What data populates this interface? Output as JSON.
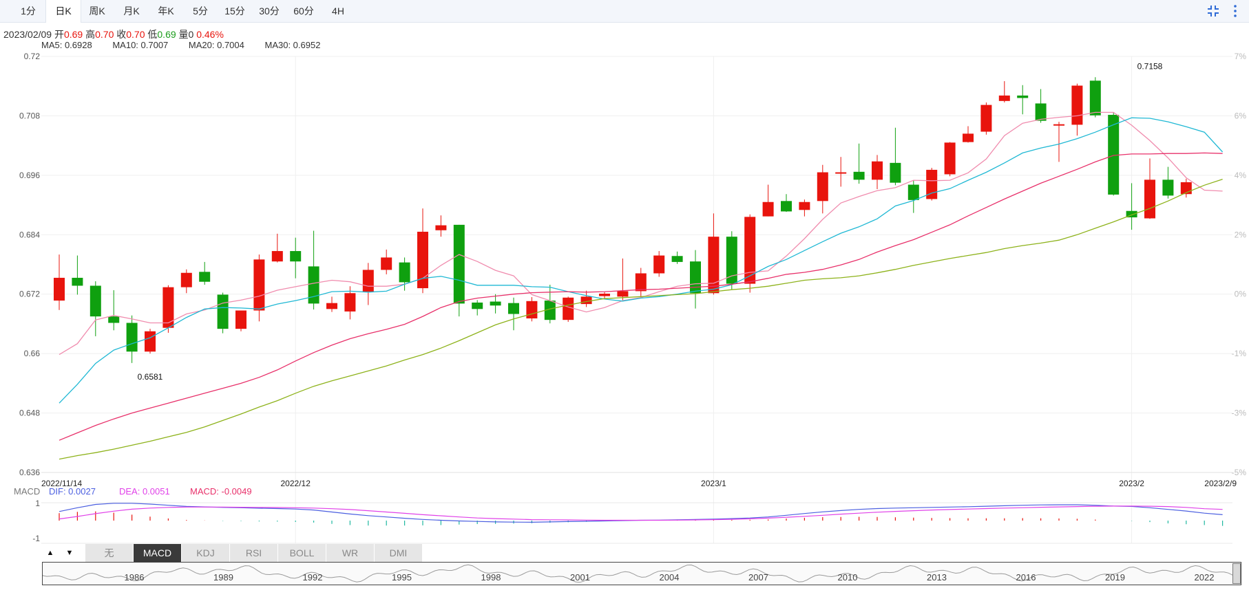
{
  "tabs": [
    {
      "label": "1分",
      "active": false
    },
    {
      "label": "日K",
      "active": true
    },
    {
      "label": "周K",
      "active": false
    },
    {
      "label": "月K",
      "active": false
    },
    {
      "label": "年K",
      "active": false
    },
    {
      "label": "5分",
      "active": false
    },
    {
      "label": "15分",
      "active": false
    },
    {
      "label": "30分",
      "active": false
    },
    {
      "label": "60分",
      "active": false
    },
    {
      "label": "4H",
      "active": false
    }
  ],
  "info": {
    "date": "2023/02/09",
    "open_label": "开",
    "open": "0.69",
    "high_label": "高",
    "high": "0.70",
    "close_label": "收",
    "close": "0.70",
    "low_label": "低",
    "low": "0.69",
    "volume_label": "量",
    "volume": "0",
    "change": "0.46%"
  },
  "ma_legend": [
    {
      "text": "MA5: 0.6928",
      "color": "#f08cae"
    },
    {
      "text": "MA10: 0.7007",
      "color": "#1fb8d4"
    },
    {
      "text": "MA20: 0.7004",
      "color": "#e8306a"
    },
    {
      "text": "MA30: 0.6952",
      "color": "#8db21a"
    }
  ],
  "macd_legend": {
    "title": "MACD",
    "dif": "DIF: 0.0027",
    "dea": "DEA: 0.0051",
    "macd": "MACD: -0.0049"
  },
  "indicator_tabs": [
    {
      "label": "无",
      "active": false
    },
    {
      "label": "MACD",
      "active": true
    },
    {
      "label": "KDJ",
      "active": false
    },
    {
      "label": "RSI",
      "active": false
    },
    {
      "label": "BOLL",
      "active": false
    },
    {
      "label": "WR",
      "active": false
    },
    {
      "label": "DMI",
      "active": false
    }
  ],
  "nav_arrows": {
    "up": "▲",
    "down": "▼"
  },
  "colors": {
    "up": "#e8140d",
    "down": "#0fa00f",
    "dif": "#4a5ee0",
    "dea": "#e040e8"
  },
  "chart_data": {
    "type": "candlestick",
    "ylim": [
      0.636,
      0.72
    ],
    "y_ticks": [
      "0.72",
      "0.708",
      "0.696",
      "0.684",
      "0.672",
      "0.66",
      "0.648",
      "0.636"
    ],
    "pct_ticks": [
      "7%",
      "6%",
      "4%",
      "2%",
      "0%",
      "-1%",
      "-3%",
      "-5%"
    ],
    "x_labels": [
      {
        "label": "2022/11/14",
        "index": 0
      },
      {
        "label": "2022/12",
        "index": 13
      },
      {
        "label": "2023/1",
        "index": 36
      },
      {
        "label": "2023/2",
        "index": 59
      },
      {
        "label": "2023/2/9",
        "index": 65
      }
    ],
    "annotations": [
      {
        "text": "0.6581",
        "index": 5,
        "value": 0.6581,
        "position": "below"
      },
      {
        "text": "0.7158",
        "index": 60,
        "value": 0.7158,
        "position": "above"
      }
    ],
    "candles": [
      [
        0.6707,
        0.6753,
        0.6688,
        0.68
      ],
      [
        0.6753,
        0.6737,
        0.6719,
        0.6798
      ],
      [
        0.6737,
        0.6675,
        0.6635,
        0.6746
      ],
      [
        0.6675,
        0.6662,
        0.6647,
        0.6728
      ],
      [
        0.6662,
        0.6604,
        0.6581,
        0.6677
      ],
      [
        0.6604,
        0.6645,
        0.66,
        0.665
      ],
      [
        0.6652,
        0.6734,
        0.6642,
        0.6738
      ],
      [
        0.6734,
        0.6763,
        0.6722,
        0.677
      ],
      [
        0.6765,
        0.6745,
        0.6739,
        0.6785
      ],
      [
        0.6719,
        0.665,
        0.6641,
        0.6723
      ],
      [
        0.665,
        0.6687,
        0.6645,
        0.6687
      ],
      [
        0.6687,
        0.679,
        0.6665,
        0.68
      ],
      [
        0.6786,
        0.6807,
        0.6784,
        0.6842
      ],
      [
        0.6807,
        0.6786,
        0.6752,
        0.6834
      ],
      [
        0.6776,
        0.6701,
        0.6689,
        0.6848
      ],
      [
        0.669,
        0.6702,
        0.6684,
        0.6715
      ],
      [
        0.6685,
        0.6722,
        0.6669,
        0.6736
      ],
      [
        0.6725,
        0.6769,
        0.6698,
        0.6783
      ],
      [
        0.6769,
        0.6794,
        0.676,
        0.681
      ],
      [
        0.6784,
        0.6744,
        0.6727,
        0.6794
      ],
      [
        0.6732,
        0.6846,
        0.6722,
        0.6893
      ],
      [
        0.6849,
        0.6859,
        0.6836,
        0.6879
      ],
      [
        0.686,
        0.6701,
        0.6675,
        0.686
      ],
      [
        0.6703,
        0.669,
        0.6677,
        0.6708
      ],
      [
        0.6705,
        0.6697,
        0.6681,
        0.672
      ],
      [
        0.6702,
        0.668,
        0.6647,
        0.6713
      ],
      [
        0.6671,
        0.6706,
        0.6665,
        0.6714
      ],
      [
        0.6707,
        0.6668,
        0.6661,
        0.6739
      ],
      [
        0.6668,
        0.6713,
        0.6664,
        0.6715
      ],
      [
        0.67,
        0.6715,
        0.6694,
        0.6727
      ],
      [
        0.6716,
        0.6721,
        0.6711,
        0.6724
      ],
      [
        0.6715,
        0.6726,
        0.6708,
        0.6792
      ],
      [
        0.6726,
        0.6762,
        0.6713,
        0.6773
      ],
      [
        0.6762,
        0.6798,
        0.6755,
        0.6807
      ],
      [
        0.6797,
        0.6785,
        0.6781,
        0.6806
      ],
      [
        0.6786,
        0.6722,
        0.6691,
        0.6809
      ],
      [
        0.6722,
        0.6836,
        0.6719,
        0.6883
      ],
      [
        0.6836,
        0.6741,
        0.673,
        0.6847
      ],
      [
        0.6741,
        0.6876,
        0.6723,
        0.6881
      ],
      [
        0.6877,
        0.6906,
        0.6877,
        0.6941
      ],
      [
        0.6908,
        0.6887,
        0.6886,
        0.6922
      ],
      [
        0.689,
        0.6906,
        0.6877,
        0.6911
      ],
      [
        0.6908,
        0.6966,
        0.6883,
        0.6981
      ],
      [
        0.6965,
        0.6966,
        0.6937,
        0.6997
      ],
      [
        0.6967,
        0.6951,
        0.6943,
        0.7024
      ],
      [
        0.6951,
        0.6988,
        0.6932,
        0.7001
      ],
      [
        0.6985,
        0.6945,
        0.694,
        0.7056
      ],
      [
        0.6941,
        0.691,
        0.6884,
        0.695
      ],
      [
        0.6912,
        0.6971,
        0.6909,
        0.6975
      ],
      [
        0.6962,
        0.7026,
        0.6958,
        0.7027
      ],
      [
        0.7027,
        0.7044,
        0.7026,
        0.7059
      ],
      [
        0.7048,
        0.7102,
        0.7042,
        0.7107
      ],
      [
        0.711,
        0.7121,
        0.7107,
        0.715
      ],
      [
        0.7121,
        0.7116,
        0.7083,
        0.7142
      ],
      [
        0.7105,
        0.707,
        0.7066,
        0.7134
      ],
      [
        0.7062,
        0.7063,
        0.6987,
        0.7068
      ],
      [
        0.7062,
        0.7141,
        0.704,
        0.7145
      ],
      [
        0.7151,
        0.7081,
        0.7077,
        0.7158
      ],
      [
        0.7082,
        0.6921,
        0.6919,
        0.7087
      ],
      [
        0.6888,
        0.6875,
        0.685,
        0.6944
      ],
      [
        0.6873,
        0.6951,
        0.6872,
        0.6994
      ],
      [
        0.6951,
        0.6919,
        0.6913,
        0.6977
      ],
      [
        0.6922,
        0.6946,
        0.6915,
        0.6953
      ]
    ],
    "candle_format": [
      "open",
      "close",
      "low",
      "high"
    ],
    "ma_series": [
      {
        "name": "MA5",
        "color": "#f08cae",
        "values": [
          0.6598,
          0.662,
          0.6668,
          0.6677,
          0.667,
          0.6662,
          0.6662,
          0.668,
          0.6688,
          0.6702,
          0.6708,
          0.6716,
          0.6728,
          0.6735,
          0.6742,
          0.6748,
          0.6745,
          0.6736,
          0.6736,
          0.674,
          0.6752,
          0.6778,
          0.68,
          0.6786,
          0.6768,
          0.6757,
          0.6719,
          0.6707,
          0.6694,
          0.6684,
          0.6693,
          0.6707,
          0.6713,
          0.6725,
          0.6736,
          0.6741,
          0.6742,
          0.6757,
          0.6764,
          0.6767,
          0.6797,
          0.6832,
          0.6871,
          0.6904,
          0.6917,
          0.6929,
          0.6935,
          0.695,
          0.6949,
          0.695,
          0.6965,
          0.6993,
          0.704,
          0.7065,
          0.7073,
          0.7077,
          0.708,
          0.7087,
          0.7087,
          0.7061,
          0.703,
          0.6995,
          0.6955,
          0.693,
          0.6928
        ]
      },
      {
        "name": "MA10",
        "color": "#1fb8d4",
        "values": [
          0.65,
          0.6538,
          0.658,
          0.6607,
          0.662,
          0.6632,
          0.6652,
          0.6673,
          0.669,
          0.6693,
          0.6692,
          0.669,
          0.67,
          0.6707,
          0.6715,
          0.6725,
          0.6726,
          0.6724,
          0.6726,
          0.674,
          0.6752,
          0.6756,
          0.6748,
          0.6738,
          0.6738,
          0.6738,
          0.6735,
          0.6734,
          0.6725,
          0.6717,
          0.671,
          0.6706,
          0.6712,
          0.6715,
          0.672,
          0.6726,
          0.673,
          0.6739,
          0.6757,
          0.6776,
          0.679,
          0.6808,
          0.6826,
          0.6843,
          0.6856,
          0.6872,
          0.6898,
          0.6909,
          0.6924,
          0.6933,
          0.695,
          0.6966,
          0.6985,
          0.7005,
          0.7015,
          0.7023,
          0.7034,
          0.7047,
          0.7062,
          0.7076,
          0.7075,
          0.7068,
          0.7058,
          0.7047,
          0.7007
        ]
      },
      {
        "name": "MA20",
        "color": "#e8306a",
        "values": [
          0.6425,
          0.644,
          0.6455,
          0.6468,
          0.648,
          0.649,
          0.65,
          0.651,
          0.652,
          0.653,
          0.654,
          0.6552,
          0.6567,
          0.6585,
          0.6602,
          0.6617,
          0.663,
          0.664,
          0.6649,
          0.6659,
          0.6675,
          0.6693,
          0.6705,
          0.6712,
          0.6716,
          0.672,
          0.6723,
          0.6724,
          0.6725,
          0.6724,
          0.6725,
          0.6727,
          0.6729,
          0.673,
          0.6732,
          0.6734,
          0.6736,
          0.674,
          0.6745,
          0.6752,
          0.676,
          0.6764,
          0.677,
          0.6779,
          0.679,
          0.6805,
          0.6818,
          0.683,
          0.6845,
          0.686,
          0.6878,
          0.6895,
          0.6912,
          0.6928,
          0.6944,
          0.6958,
          0.6972,
          0.6987,
          0.7,
          0.7003,
          0.7003,
          0.7004,
          0.7004,
          0.7005,
          0.7004
        ]
      },
      {
        "name": "MA30",
        "color": "#8db21a",
        "values": [
          0.6387,
          0.6394,
          0.64,
          0.6407,
          0.6415,
          0.6423,
          0.6432,
          0.6441,
          0.6452,
          0.6465,
          0.6478,
          0.6492,
          0.6505,
          0.652,
          0.6534,
          0.6545,
          0.6555,
          0.6565,
          0.6575,
          0.6587,
          0.6598,
          0.6611,
          0.6626,
          0.6642,
          0.6658,
          0.667,
          0.668,
          0.669,
          0.6698,
          0.6705,
          0.6711,
          0.6713,
          0.6715,
          0.6717,
          0.6719,
          0.6721,
          0.6725,
          0.6729,
          0.6732,
          0.6736,
          0.6742,
          0.6748,
          0.6751,
          0.6753,
          0.6757,
          0.6763,
          0.677,
          0.6778,
          0.6785,
          0.6792,
          0.6798,
          0.6804,
          0.6812,
          0.6818,
          0.6823,
          0.6829,
          0.684,
          0.6853,
          0.6866,
          0.688,
          0.6893,
          0.6908,
          0.6925,
          0.694,
          0.6952
        ]
      }
    ],
    "macd": {
      "ylim": [
        -1,
        1
      ],
      "y_ticks": [
        "1",
        "-1"
      ],
      "dif": [
        0.55,
        0.78,
        0.98,
        1.05,
        1.05,
        1.0,
        0.93,
        0.86,
        0.83,
        0.8,
        0.78,
        0.75,
        0.73,
        0.7,
        0.64,
        0.52,
        0.4,
        0.3,
        0.22,
        0.14,
        0.07,
        0.02,
        -0.02,
        -0.05,
        -0.08,
        -0.09,
        -0.1,
        -0.08,
        -0.06,
        -0.04,
        -0.02,
        0.0,
        0.02,
        0.03,
        0.05,
        0.07,
        0.09,
        0.12,
        0.16,
        0.22,
        0.32,
        0.43,
        0.53,
        0.61,
        0.68,
        0.73,
        0.76,
        0.78,
        0.8,
        0.82,
        0.84,
        0.87,
        0.9,
        0.93,
        0.95,
        0.96,
        0.96,
        0.93,
        0.88,
        0.86,
        0.78,
        0.68,
        0.58,
        0.45,
        0.36
      ],
      "dea": [
        0.1,
        0.25,
        0.42,
        0.57,
        0.69,
        0.76,
        0.8,
        0.82,
        0.82,
        0.82,
        0.81,
        0.8,
        0.79,
        0.78,
        0.76,
        0.72,
        0.67,
        0.6,
        0.52,
        0.44,
        0.36,
        0.29,
        0.22,
        0.16,
        0.12,
        0.09,
        0.06,
        0.05,
        0.04,
        0.03,
        0.02,
        0.02,
        0.02,
        0.02,
        0.03,
        0.04,
        0.06,
        0.08,
        0.11,
        0.15,
        0.2,
        0.26,
        0.32,
        0.39,
        0.45,
        0.51,
        0.56,
        0.6,
        0.64,
        0.67,
        0.7,
        0.73,
        0.76,
        0.78,
        0.81,
        0.83,
        0.85,
        0.87,
        0.88,
        0.88,
        0.87,
        0.85,
        0.8,
        0.72,
        0.68
      ],
      "hist": [
        0.45,
        0.53,
        0.56,
        0.48,
        0.36,
        0.24,
        0.13,
        0.04,
        0.01,
        -0.02,
        -0.03,
        -0.05,
        -0.06,
        -0.08,
        -0.12,
        -0.2,
        -0.27,
        -0.3,
        -0.3,
        -0.3,
        -0.29,
        -0.27,
        -0.24,
        -0.21,
        -0.2,
        -0.18,
        -0.16,
        -0.13,
        -0.1,
        -0.07,
        -0.04,
        -0.02,
        0.0,
        0.01,
        0.02,
        0.03,
        0.03,
        0.04,
        0.05,
        0.07,
        0.12,
        0.17,
        0.21,
        0.22,
        0.23,
        0.22,
        0.2,
        0.18,
        0.16,
        0.15,
        0.14,
        0.14,
        0.14,
        0.15,
        0.14,
        0.13,
        0.11,
        0.06,
        0.0,
        -0.02,
        -0.09,
        -0.17,
        -0.22,
        -0.27,
        -0.32
      ]
    },
    "navigator": {
      "years": [
        "1986",
        "1989",
        "1992",
        "1995",
        "1998",
        "2001",
        "2004",
        "2007",
        "2010",
        "2013",
        "2016",
        "2019",
        "2022"
      ]
    }
  }
}
